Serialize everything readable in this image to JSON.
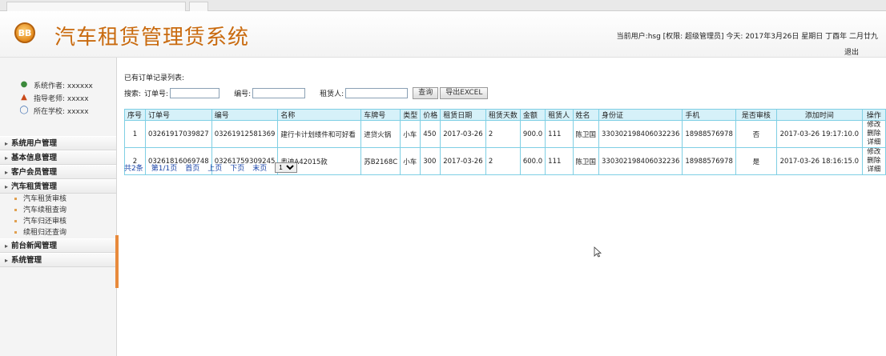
{
  "header": {
    "logo_text": "BB",
    "title": "汽车租赁管理赁系统",
    "user_info": "当前用户:hsg [权限: 超级管理员] 今天: 2017年3月26日 星期日 丁酉年 二月廿九",
    "logout": "退出"
  },
  "sidebar": {
    "info": [
      {
        "icon": "users-icon",
        "label": "系统作者: xxxxxx"
      },
      {
        "icon": "teacher-icon",
        "label": "指导老师: xxxxx"
      },
      {
        "icon": "school-icon",
        "label": "所在学校: xxxxx"
      }
    ],
    "menu": [
      {
        "label": "系统用户管理"
      },
      {
        "label": "基本信息管理"
      },
      {
        "label": "客户会员管理"
      },
      {
        "label": "汽车租赁管理"
      },
      {
        "label": "前台新闻管理"
      },
      {
        "label": "系统管理"
      }
    ],
    "submenu": [
      "汽车租赁审核",
      "汽车续租查询",
      "汽车归还审核",
      "续租归还查询"
    ]
  },
  "main": {
    "caption": "已有订单记录列表:",
    "search": {
      "label": "搜索:",
      "order_label": "订单号:",
      "code_label": "编号:",
      "renter_label": "租赁人:",
      "query_button": "查询",
      "export_button": "导出EXCEL"
    },
    "table": {
      "columns": [
        "序号",
        "订单号",
        "编号",
        "名称",
        "车牌号",
        "类型",
        "价格",
        "租赁日期",
        "租赁天数",
        "金额",
        "租赁人",
        "姓名",
        "身份证",
        "手机",
        "是否审核",
        "添加时间",
        "操作"
      ],
      "rows": [
        [
          "1",
          "03261917039827",
          "03261912581369",
          "建行卡计划缕件和可好看",
          "进贷火锅",
          "小车",
          "450",
          "2017-03-26",
          "2",
          "900.0",
          "111",
          "陈卫国",
          "330302198406032236",
          "18988576978",
          "否",
          "2017-03-26 19:17:10.0"
        ],
        [
          "2",
          "03261816069748",
          "03261759309245",
          "奥迪A42015款",
          "苏B2168C",
          "小车",
          "300",
          "2017-03-26",
          "2",
          "600.0",
          "111",
          "陈卫国",
          "330302198406032236",
          "18988576978",
          "是",
          "2017-03-26 18:16:15.0"
        ]
      ],
      "actions": {
        "edit": "修改",
        "delete": "删除",
        "detail": "详细"
      }
    },
    "pager": {
      "total": "共2条",
      "page_info": "第1/1页",
      "first": "首页",
      "prev": "上页",
      "next": "下页",
      "last": "末页",
      "page_select": "1"
    }
  }
}
